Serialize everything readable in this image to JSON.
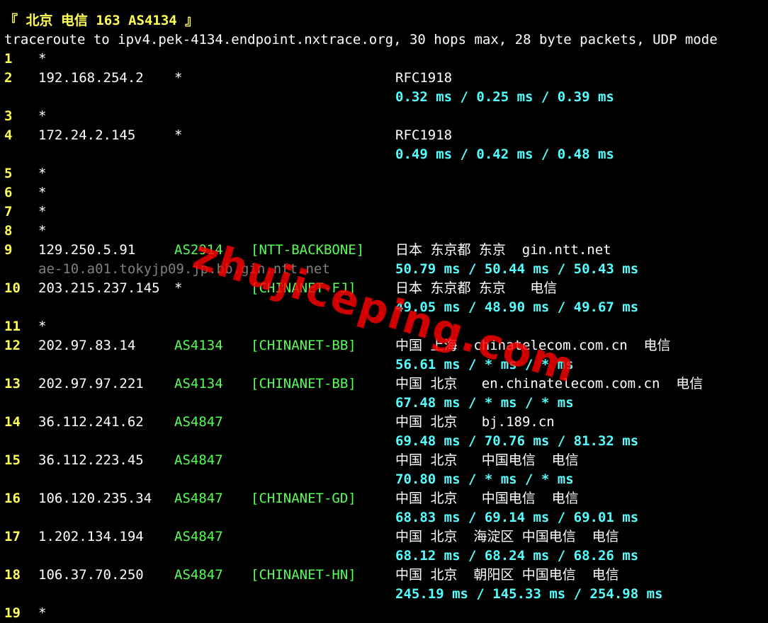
{
  "window_title": "『 北京 电信 163 AS4134 』",
  "command_line": "traceroute to ipv4.pek-4134.endpoint.nxtrace.org, 30 hops max, 28 byte packets, UDP mode",
  "watermark": "zhujiceping.com",
  "colors": {
    "background": "#000000",
    "hop_number": "#ffff55",
    "asn": "#55ff55",
    "rtt": "#55ffff",
    "text": "#ffffff",
    "rdns": "#808080",
    "watermark": "#ff0000"
  },
  "hops": [
    {
      "num": "1",
      "ip": "*"
    },
    {
      "num": "2",
      "ip": "192.168.254.2",
      "asn": "*",
      "geo": "RFC1918",
      "rtt": "0.32 ms / 0.25 ms / 0.39 ms"
    },
    {
      "num": "3",
      "ip": "*"
    },
    {
      "num": "4",
      "ip": "172.24.2.145",
      "asn": "*",
      "geo": "RFC1918",
      "rtt": "0.49 ms / 0.42 ms / 0.48 ms"
    },
    {
      "num": "5",
      "ip": "*"
    },
    {
      "num": "6",
      "ip": "*"
    },
    {
      "num": "7",
      "ip": "*"
    },
    {
      "num": "8",
      "ip": "*"
    },
    {
      "num": "9",
      "ip": "129.250.5.91",
      "asn": "AS2914",
      "network": "[NTT-BACKBONE]",
      "geo": "日本 东京都 东京  gin.ntt.net",
      "rdns": "ae-10.a01.tokyjp09.jp.bb.gin.ntt.net",
      "rtt": "50.79 ms / 50.44 ms / 50.43 ms"
    },
    {
      "num": "10",
      "ip": "203.215.237.145",
      "asn": "*",
      "network": "[CHINANET-FJ]",
      "geo": "日本 东京都 东京   电信",
      "rtt": "49.05 ms / 48.90 ms / 49.67 ms"
    },
    {
      "num": "11",
      "ip": "*"
    },
    {
      "num": "12",
      "ip": "202.97.83.14",
      "asn": "AS4134",
      "network": "[CHINANET-BB]",
      "geo": "中国 上海  chinatelecom.com.cn  电信",
      "rtt": "56.61 ms / * ms / * ms"
    },
    {
      "num": "13",
      "ip": "202.97.97.221",
      "asn": "AS4134",
      "network": "[CHINANET-BB]",
      "geo": "中国 北京   en.chinatelecom.com.cn  电信",
      "rtt": "67.48 ms / * ms / * ms"
    },
    {
      "num": "14",
      "ip": "36.112.241.62",
      "asn": "AS4847",
      "geo": "中国 北京   bj.189.cn",
      "rtt": "69.48 ms / 70.76 ms / 81.32 ms"
    },
    {
      "num": "15",
      "ip": "36.112.223.45",
      "asn": "AS4847",
      "geo": "中国 北京   中国电信  电信",
      "rtt": "70.80 ms / * ms / * ms"
    },
    {
      "num": "16",
      "ip": "106.120.235.34",
      "asn": "AS4847",
      "network": "[CHINANET-GD]",
      "geo": "中国 北京   中国电信  电信",
      "rtt": "68.83 ms / 69.14 ms / 69.01 ms"
    },
    {
      "num": "17",
      "ip": "1.202.134.194",
      "asn": "AS4847",
      "geo": "中国 北京  海淀区 中国电信  电信",
      "rtt": "68.12 ms / 68.24 ms / 68.26 ms"
    },
    {
      "num": "18",
      "ip": "106.37.70.250",
      "asn": "AS4847",
      "network": "[CHINANET-HN]",
      "geo": "中国 北京  朝阳区 中国电信  电信",
      "rtt": "245.19 ms / 145.33 ms / 254.98 ms"
    },
    {
      "num": "19",
      "ip": "*"
    }
  ]
}
